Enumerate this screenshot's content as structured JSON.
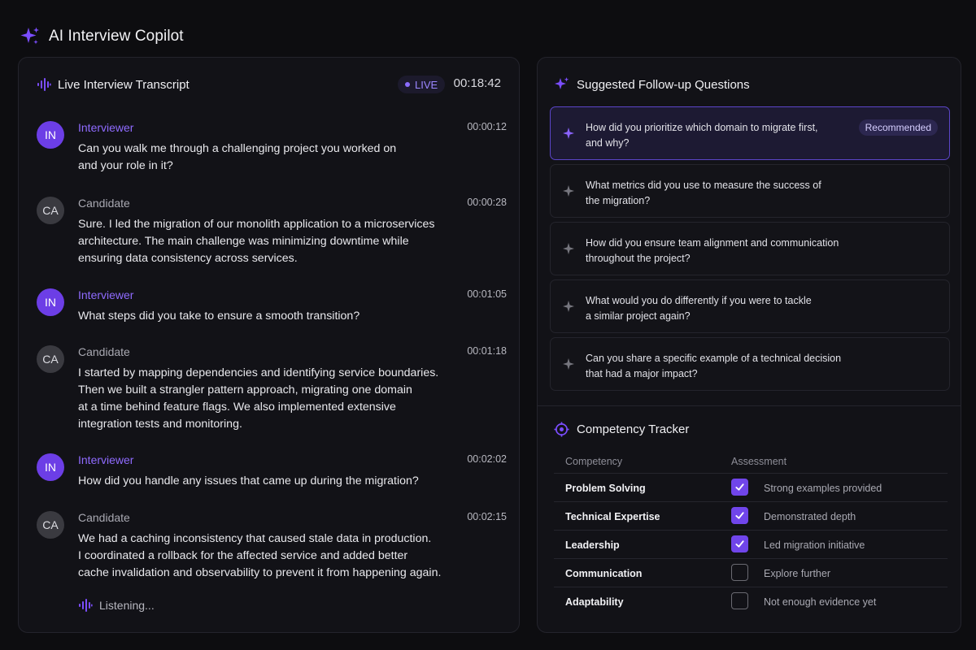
{
  "app": {
    "title": "AI Interview Copilot",
    "accent": "#7b4dff"
  },
  "transcript": {
    "title": "Live Interview Transcript",
    "live_label": "LIVE",
    "timer": "00:18:42",
    "messages": [
      {
        "initials": "IN",
        "speaker": "Interviewer",
        "time": "00:00:12",
        "text": "Can you walk me through a challenging project you worked on\nand your role in it?"
      },
      {
        "initials": "CA",
        "speaker": "Candidate",
        "time": "00:00:28",
        "text": "Sure. I led the migration of our monolith application to a microservices\narchitecture. The main challenge was minimizing downtime while\nensuring data consistency across services."
      },
      {
        "initials": "IN",
        "speaker": "Interviewer",
        "time": "00:01:05",
        "text": "What steps did you take to ensure a smooth transition?"
      },
      {
        "initials": "CA",
        "speaker": "Candidate",
        "time": "00:01:18",
        "text": "I started by mapping dependencies and identifying service boundaries.\nThen we built a strangler pattern approach, migrating one domain\nat a time behind feature flags. We also implemented extensive\nintegration tests and monitoring."
      },
      {
        "initials": "IN",
        "speaker": "Interviewer",
        "time": "00:02:02",
        "text": "How did you handle any issues that came up during the migration?"
      },
      {
        "initials": "CA",
        "speaker": "Candidate",
        "time": "00:02:15",
        "text": "We had a caching inconsistency that caused stale data in production.\nI coordinated a rollback for the affected service and added better\ncache invalidation and observability to prevent it from happening again."
      }
    ],
    "listening_label": "Listening..."
  },
  "suggestions": {
    "title": "Suggested Follow-up Questions",
    "recommended_label": "Recommended",
    "questions": [
      "How did you prioritize which domain to migrate first,\nand why?",
      "What metrics did you use to measure the success of\nthe migration?",
      "How did you ensure team alignment and communication\nthroughout the project?",
      "What would you do differently if you were to tackle\na similar project again?",
      "Can you share a specific example of a technical decision\nthat had a major impact?"
    ]
  },
  "competency": {
    "title": "Competency Tracker",
    "col_competency": "Competency",
    "col_assessment": "Assessment",
    "rows": [
      {
        "name": "Problem Solving",
        "checked": true,
        "note": "Strong examples provided"
      },
      {
        "name": "Technical Expertise",
        "checked": true,
        "note": "Demonstrated depth"
      },
      {
        "name": "Leadership",
        "checked": true,
        "note": "Led migration initiative"
      },
      {
        "name": "Communication",
        "checked": false,
        "note": "Explore further"
      },
      {
        "name": "Adaptability",
        "checked": false,
        "note": "Not enough evidence yet"
      }
    ]
  }
}
